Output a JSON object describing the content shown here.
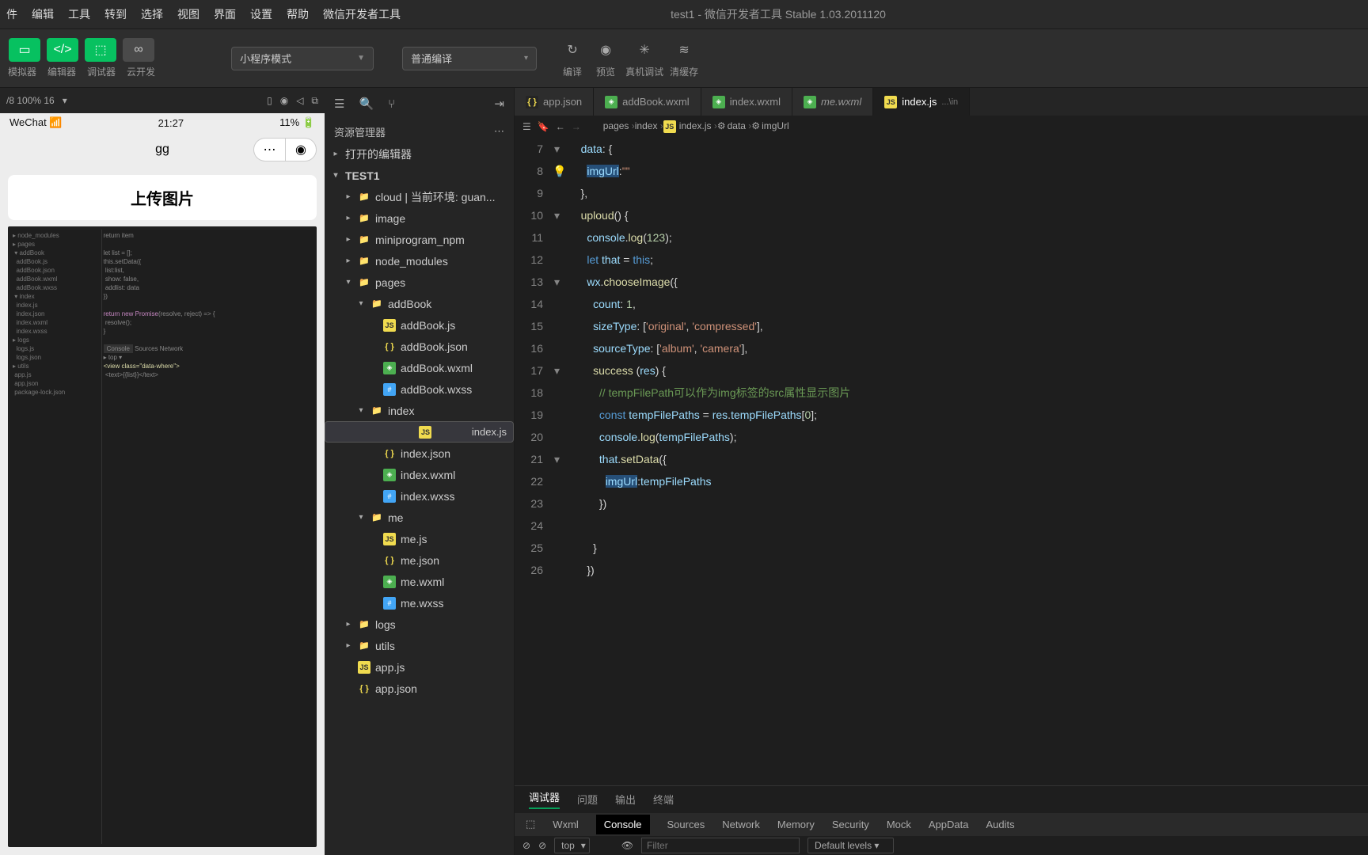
{
  "menu": [
    "件",
    "编辑",
    "工具",
    "转到",
    "选择",
    "视图",
    "界面",
    "设置",
    "帮助",
    "微信开发者工具"
  ],
  "windowTitle": "test1  -  微信开发者工具 Stable 1.03.2011120",
  "toolbar": {
    "simulator": "模拟器",
    "editor": "编辑器",
    "debugger": "调试器",
    "cloud": "云开发",
    "mode": "小程序模式",
    "compileMode": "普通编译",
    "compile": "编译",
    "preview": "预览",
    "realDebug": "真机调试",
    "clearCache": "清缓存"
  },
  "simTop": {
    "zoom": "/8 100% 16"
  },
  "phone": {
    "carrier": "WeChat",
    "time": "21:27",
    "battery": "11%",
    "title": "gg",
    "upload": "上传图片"
  },
  "explorer": {
    "title": "资源管理器",
    "openEditors": "打开的编辑器",
    "project": "TEST1",
    "items": [
      {
        "d": 1,
        "t": "folder-g",
        "label": "cloud | 当前环境: guan...",
        "tw": "▸"
      },
      {
        "d": 1,
        "t": "folder-g",
        "label": "image",
        "tw": "▸"
      },
      {
        "d": 1,
        "t": "folder-g",
        "label": "miniprogram_npm",
        "tw": "▸"
      },
      {
        "d": 1,
        "t": "folder-g",
        "label": "node_modules",
        "tw": "▸"
      },
      {
        "d": 1,
        "t": "folder",
        "label": "pages",
        "tw": "▾"
      },
      {
        "d": 2,
        "t": "folder",
        "label": "addBook",
        "tw": "▾"
      },
      {
        "d": 3,
        "t": "js",
        "label": "addBook.js"
      },
      {
        "d": 3,
        "t": "json",
        "label": "addBook.json"
      },
      {
        "d": 3,
        "t": "wxml",
        "label": "addBook.wxml"
      },
      {
        "d": 3,
        "t": "wxss",
        "label": "addBook.wxss"
      },
      {
        "d": 2,
        "t": "folder",
        "label": "index",
        "tw": "▾"
      },
      {
        "d": 3,
        "t": "js",
        "label": "index.js",
        "sel": true
      },
      {
        "d": 3,
        "t": "json",
        "label": "index.json"
      },
      {
        "d": 3,
        "t": "wxml",
        "label": "index.wxml"
      },
      {
        "d": 3,
        "t": "wxss",
        "label": "index.wxss"
      },
      {
        "d": 2,
        "t": "folder",
        "label": "me",
        "tw": "▾"
      },
      {
        "d": 3,
        "t": "js",
        "label": "me.js"
      },
      {
        "d": 3,
        "t": "json",
        "label": "me.json"
      },
      {
        "d": 3,
        "t": "wxml",
        "label": "me.wxml"
      },
      {
        "d": 3,
        "t": "wxss",
        "label": "me.wxss"
      },
      {
        "d": 1,
        "t": "folder-g",
        "label": "logs",
        "tw": "▸"
      },
      {
        "d": 1,
        "t": "folder",
        "label": "utils",
        "tw": "▸"
      },
      {
        "d": 1,
        "t": "js",
        "label": "app.js"
      },
      {
        "d": 1,
        "t": "json",
        "label": "app.json"
      }
    ]
  },
  "tabs": [
    {
      "icon": "json",
      "label": "app.json"
    },
    {
      "icon": "wxml",
      "label": "addBook.wxml"
    },
    {
      "icon": "wxml",
      "label": "index.wxml"
    },
    {
      "icon": "wxml",
      "label": "me.wxml",
      "italic": true
    },
    {
      "icon": "js",
      "label": "index.js",
      "suffix": "...\\in",
      "active": true
    }
  ],
  "breadcrumb": [
    "pages",
    "index",
    "index.js",
    "data",
    "imgUrl"
  ],
  "code": {
    "start": 7,
    "lines": [
      {
        "n": 7,
        "f": "▾",
        "html": "    <span class='pr'>data</span>: {"
      },
      {
        "n": 8,
        "f": "",
        "html": "      <span class='hl'><span class='pr'>imgUrl</span></span>:<span class='s'>\"\"</span>",
        "bulb": true
      },
      {
        "n": 9,
        "f": "",
        "html": "    },"
      },
      {
        "n": 10,
        "f": "▾",
        "html": "    <span class='fn'>uploud</span>() {"
      },
      {
        "n": 11,
        "f": "",
        "html": "      <span class='pr'>console</span>.<span class='fn'>log</span>(<span class='n'>123</span>);"
      },
      {
        "n": 12,
        "f": "",
        "html": "      <span class='k'>let</span> <span class='pr'>that</span> = <span class='k'>this</span>;"
      },
      {
        "n": 13,
        "f": "▾",
        "html": "      <span class='pr'>wx</span>.<span class='fn'>chooseImage</span>({"
      },
      {
        "n": 14,
        "f": "",
        "html": "        <span class='pr'>count</span>: <span class='n'>1</span>,"
      },
      {
        "n": 15,
        "f": "",
        "html": "        <span class='pr'>sizeType</span>: [<span class='s'>'original'</span>, <span class='s'>'compressed'</span>],"
      },
      {
        "n": 16,
        "f": "",
        "html": "        <span class='pr'>sourceType</span>: [<span class='s'>'album'</span>, <span class='s'>'camera'</span>],"
      },
      {
        "n": 17,
        "f": "▾",
        "html": "        <span class='fn'>success</span> (<span class='pr'>res</span>) {"
      },
      {
        "n": 18,
        "f": "",
        "html": "          <span class='c'>// tempFilePath可以作为img标签的src属性显示图片</span>"
      },
      {
        "n": 19,
        "f": "",
        "html": "          <span class='k'>const</span> <span class='pr'>tempFilePaths</span> = <span class='pr'>res</span>.<span class='pr'>tempFilePaths</span>[<span class='n'>0</span>];"
      },
      {
        "n": 20,
        "f": "",
        "html": "          <span class='pr'>console</span>.<span class='fn'>log</span>(<span class='pr'>tempFilePaths</span>);"
      },
      {
        "n": 21,
        "f": "▾",
        "html": "          <span class='pr'>that</span>.<span class='fn'>setData</span>({"
      },
      {
        "n": 22,
        "f": "",
        "html": "            <span class='hl'><span class='pr'>imgUrl</span></span>:<span class='pr'>tempFilePaths</span>"
      },
      {
        "n": 23,
        "f": "",
        "html": "          <span class='p'>})</span>"
      },
      {
        "n": 24,
        "f": "",
        "html": ""
      },
      {
        "n": 25,
        "f": "",
        "html": "        }"
      },
      {
        "n": 26,
        "f": "",
        "html": "      <span class='p'>})</span>"
      }
    ]
  },
  "bottomTabs": [
    "调试器",
    "问题",
    "输出",
    "终端"
  ],
  "devTabs": [
    "Wxml",
    "Console",
    "Sources",
    "Network",
    "Memory",
    "Security",
    "Mock",
    "AppData",
    "Audits"
  ],
  "console": {
    "top": "top",
    "filter": "Filter",
    "levels": "Default levels"
  }
}
